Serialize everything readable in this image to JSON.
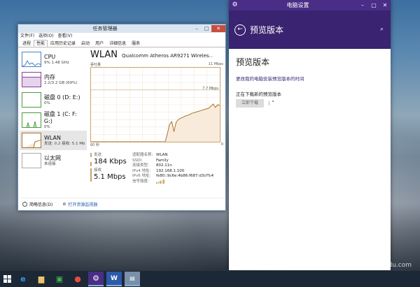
{
  "desktop": {
    "watermark": "jingyan.baidu.com"
  },
  "task_manager": {
    "title": "任务管理器",
    "menu": [
      "文件(F)",
      "选项(O)",
      "查看(V)"
    ],
    "tabs": [
      "进程",
      "性能",
      "应用历史记录",
      "启动",
      "用户",
      "详细信息",
      "服务"
    ],
    "active_tab": "性能",
    "resources": [
      {
        "name": "CPU",
        "sub": "9%  1.48 GHz"
      },
      {
        "name": "内存",
        "sub": "2.2/3.2 GB (69%)"
      },
      {
        "name": "磁盘 0 (D: E:)",
        "sub": "0%"
      },
      {
        "name": "磁盘 1 (C: F: G:)",
        "sub": "0%"
      },
      {
        "name": "WLAN",
        "sub": "发送: 0.2  接收: 5.1 Mb"
      },
      {
        "name": "以太网",
        "sub": "未连接"
      }
    ],
    "wlan": {
      "title": "WLAN",
      "adapter": "Qualcomm Atheros AR9271 Wireles...",
      "graph_label": "吞吐量",
      "graph_max": "11 Mbps",
      "graph_mid": "7.7 Mbps",
      "graph_time": "60 秒",
      "graph_zero": "0",
      "throughput": [
        0,
        0,
        0,
        0,
        0,
        0,
        0,
        0,
        0,
        0,
        0,
        0,
        0,
        0,
        0,
        0,
        0,
        0,
        0,
        0,
        0,
        0,
        0,
        0,
        0,
        0,
        0,
        0,
        0,
        0,
        0,
        0,
        0,
        0,
        0,
        1.2,
        2.6,
        3.0,
        1.5,
        2.9,
        3.3,
        3.5,
        3.6,
        3.8,
        3.9,
        4.0,
        4.2,
        4.3,
        4.4,
        4.5,
        4.6,
        4.7,
        4.8,
        4.9,
        5.0,
        5.3,
        5.6,
        5.1,
        5.5,
        5.4
      ]
    },
    "stats": {
      "send_label": "发送",
      "send_value": "184 Kbps",
      "recv_label": "接收",
      "recv_value": "5.1 Mbps"
    },
    "properties": [
      {
        "key": "适配器名称:",
        "value": "WLAN"
      },
      {
        "key": "SSID:",
        "value": "Family"
      },
      {
        "key": "连接类型:",
        "value": "802.11n"
      },
      {
        "key": "IPv4 地址:",
        "value": "192.168.1.100"
      },
      {
        "key": "IPv6 地址:",
        "value": "fe80::9c6e:4b86:f687:d3cf%4"
      },
      {
        "key": "信号强度:",
        "value": ""
      }
    ],
    "footer": {
      "brief": "简略信息(D)",
      "resmon": "打开资源监视器"
    }
  },
  "settings": {
    "window_title": "电脑设置",
    "header_title": "预览版本",
    "heading": "预览版本",
    "description": "更改我的电脑安装预览版本的时间",
    "status": "正在下载新的预览版本",
    "download_button": "立即下载",
    "spinner": "⁝ ˚"
  },
  "taskbar": {
    "word_label": "W"
  }
}
